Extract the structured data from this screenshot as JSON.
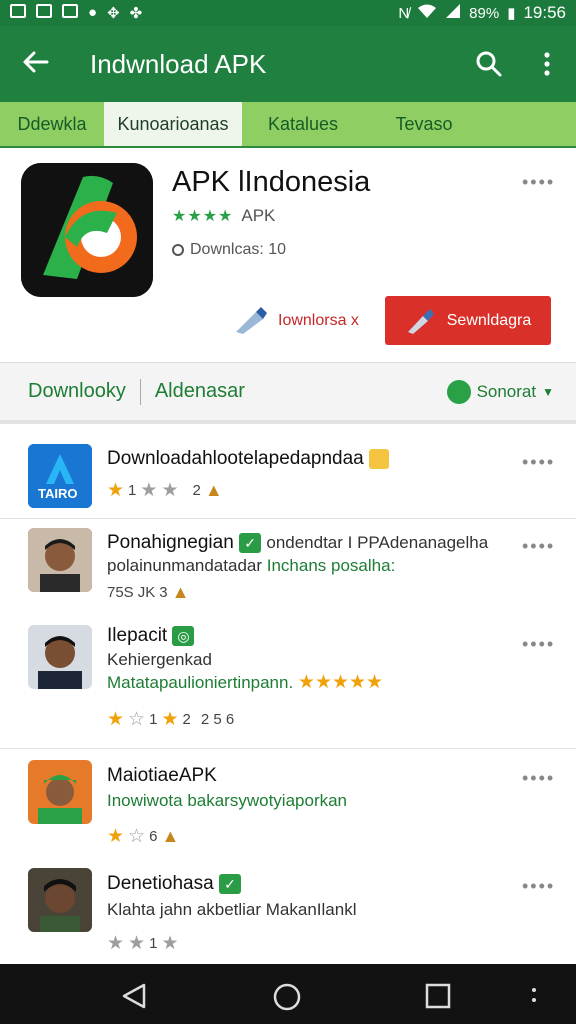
{
  "status": {
    "battery": "89%",
    "time": "19:56"
  },
  "appbar": {
    "title": "Indwnload APK"
  },
  "tabs": [
    "Ddewkla",
    "Kunoarioanas",
    "Katalues",
    "Tevaso"
  ],
  "app": {
    "name": "APK lIndonesia",
    "rating_label": "APK",
    "downloads": "Downlcas: 10",
    "btn_secondary": "Iownlorsa x",
    "btn_primary": "Sewnldagra"
  },
  "subbar": {
    "left": "Downlooky",
    "middle": "Aldenasar",
    "right": "Sonorat"
  },
  "items": [
    {
      "title": "Downloadahlootelapedapndaa",
      "meta": [
        "1",
        "2"
      ],
      "icon_text": "TAIRO"
    },
    {
      "title": "Ponahignegian",
      "subtitle_a": "ondendtar I PPAdenanagelha",
      "subtitle_b": "polainunmandatadar",
      "subtitle_c": "Inchans posalha:",
      "meta": [
        "75S",
        "JK",
        "3"
      ]
    },
    {
      "title": "Ilepacit",
      "subtitle_a": "Kehiergenkad",
      "subtitle_b": "Matatapaulioniertinpann.",
      "meta": [
        "1",
        "2",
        "2 5 6"
      ]
    },
    {
      "title": "MaiotiaeAPK",
      "subtitle_a": "Inowiwota bakarsywotyiaporkan",
      "meta": [
        "6"
      ]
    },
    {
      "title": "Denetiohasa",
      "subtitle_a": "Klahta jahn akbetliar MakanIlankl",
      "meta": [
        "1"
      ]
    }
  ],
  "colors": {
    "primary": "#1f8040",
    "accent": "#d9302a",
    "tab_bg": "#8fce63"
  }
}
